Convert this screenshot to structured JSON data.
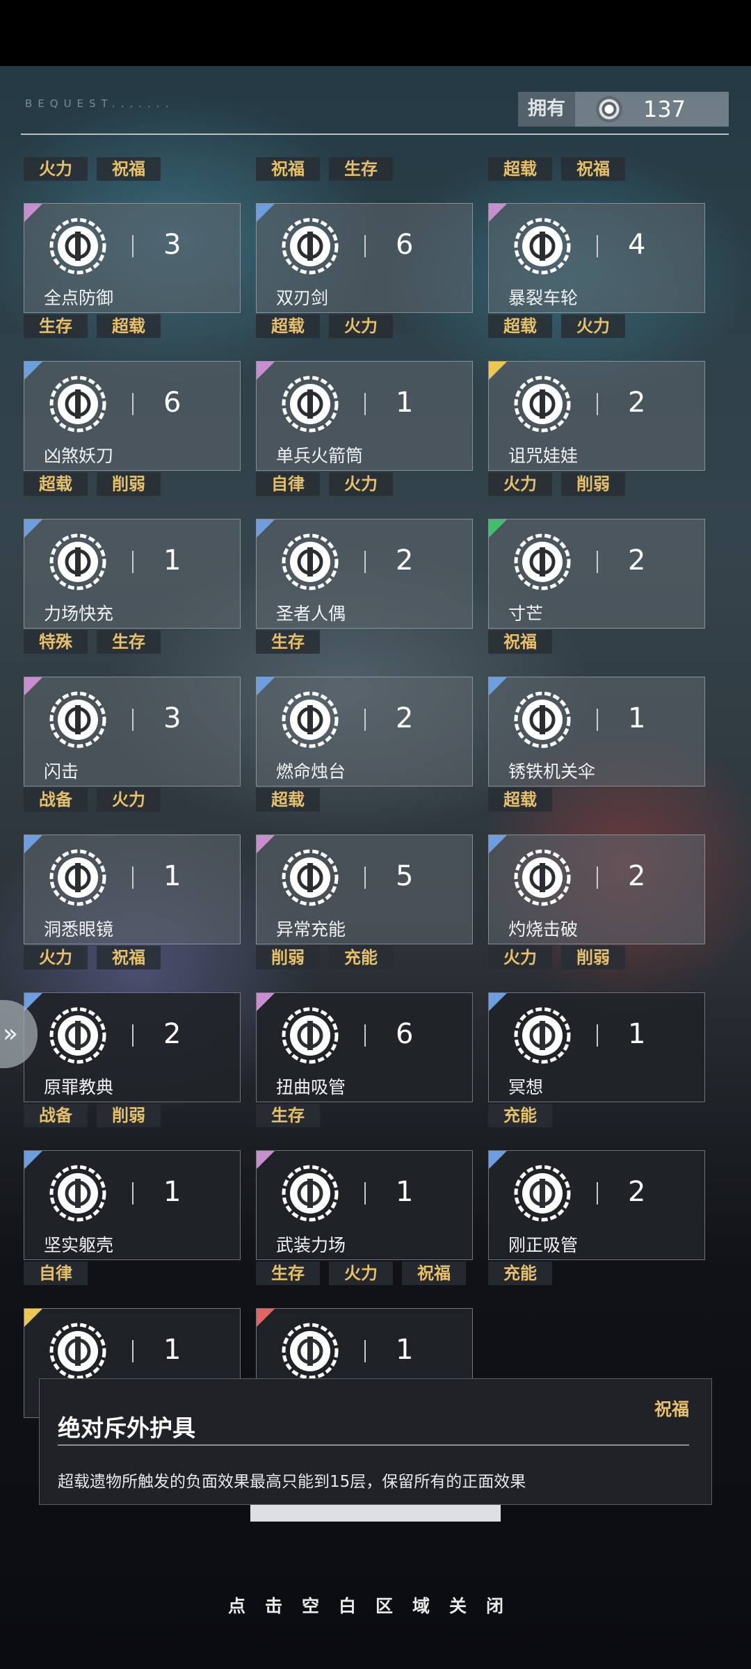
{
  "header": {
    "deco_text": "BEQUEST.......",
    "owned_label": "拥有",
    "owned_count": "137"
  },
  "colors": {
    "tag_text": "#e7c06a",
    "tri_purple": "#c88ed0",
    "tri_blue": "#6c9ee0",
    "tri_yellow": "#ecc84f",
    "tri_green": "#3fbf6a",
    "tri_red": "#e06565"
  },
  "top_tags": [
    [
      "火力",
      "祝福"
    ],
    [
      "祝福",
      "生存"
    ],
    [
      "超载",
      "祝福"
    ]
  ],
  "relics": [
    {
      "name": "全点防御",
      "count": "3",
      "rarity": "purple",
      "icon": "shield-icon",
      "tags": [
        "生存",
        "超载"
      ]
    },
    {
      "name": "双刃剑",
      "count": "6",
      "rarity": "blue",
      "icon": "double-blade-icon",
      "tags": [
        "超载",
        "火力"
      ]
    },
    {
      "name": "暴裂车轮",
      "count": "4",
      "rarity": "purple",
      "icon": "wheel-icon",
      "tags": [
        "超载",
        "火力"
      ]
    },
    {
      "name": "凶煞妖刀",
      "count": "6",
      "rarity": "blue",
      "icon": "demon-blade-icon",
      "tags": [
        "超载",
        "削弱"
      ]
    },
    {
      "name": "单兵火箭筒",
      "count": "1",
      "rarity": "purple",
      "icon": "rocket-launcher-icon",
      "tags": [
        "自律",
        "火力"
      ]
    },
    {
      "name": "诅咒娃娃",
      "count": "2",
      "rarity": "yellow",
      "icon": "voodoo-doll-icon",
      "tags": [
        "火力",
        "削弱"
      ]
    },
    {
      "name": "力场快充",
      "count": "1",
      "rarity": "blue",
      "icon": "force-field-charge-icon",
      "tags": [
        "特殊",
        "生存"
      ]
    },
    {
      "name": "圣者人偶",
      "count": "2",
      "rarity": "blue",
      "icon": "saint-figure-icon",
      "tags": [
        "生存"
      ]
    },
    {
      "name": "寸芒",
      "count": "2",
      "rarity": "green",
      "icon": "tiny-spike-icon",
      "tags": [
        "祝福"
      ]
    },
    {
      "name": "闪击",
      "count": "3",
      "rarity": "purple",
      "icon": "lightning-strike-icon",
      "tags": [
        "战备",
        "火力"
      ]
    },
    {
      "name": "燃命烛台",
      "count": "2",
      "rarity": "blue",
      "icon": "candelabra-icon",
      "tags": [
        "超载"
      ]
    },
    {
      "name": "锈铁机关伞",
      "count": "1",
      "rarity": "blue",
      "icon": "umbrella-icon",
      "tags": [
        "超载"
      ]
    },
    {
      "name": "洞悉眼镜",
      "count": "1",
      "rarity": "blue",
      "icon": "goggles-icon",
      "tags": [
        "火力",
        "祝福"
      ]
    },
    {
      "name": "异常充能",
      "count": "5",
      "rarity": "purple",
      "icon": "abnormal-charge-icon",
      "tags": [
        "削弱",
        "充能"
      ]
    },
    {
      "name": "灼烧击破",
      "count": "2",
      "rarity": "blue",
      "icon": "burn-break-icon",
      "tags": [
        "火力",
        "削弱"
      ]
    },
    {
      "name": "原罪教典",
      "count": "2",
      "rarity": "blue",
      "icon": "scripture-icon",
      "tags": [
        "战备",
        "削弱"
      ]
    },
    {
      "name": "扭曲吸管",
      "count": "6",
      "rarity": "purple",
      "icon": "twisted-straw-icon",
      "tags": [
        "生存"
      ]
    },
    {
      "name": "冥想",
      "count": "1",
      "rarity": "blue",
      "icon": "meditation-icon",
      "tags": [
        "充能"
      ]
    },
    {
      "name": "坚实躯壳",
      "count": "1",
      "rarity": "blue",
      "icon": "solid-shell-icon",
      "tags": [
        "自律"
      ]
    },
    {
      "name": "武装力场",
      "count": "1",
      "rarity": "purple",
      "icon": "armed-field-icon",
      "tags": [
        "生存",
        "火力",
        "祝福"
      ]
    },
    {
      "name": "刚正吸管",
      "count": "2",
      "rarity": "blue",
      "icon": "upright-straw-icon",
      "tags": [
        "充能"
      ]
    },
    {
      "name": "",
      "count": "1",
      "rarity": "yellow",
      "icon": "device-icon",
      "tags": []
    },
    {
      "name": "",
      "count": "1",
      "rarity": "red",
      "icon": "core-figure-icon",
      "tags": []
    }
  ],
  "tooltip": {
    "title": "绝对斥外护具",
    "tag": "祝福",
    "description": "超载遗物所触发的负面效果最高只能到15层，保留所有的正面效果"
  },
  "side_tab": {
    "icon": "double-chevron-right-icon",
    "glyph": "»"
  },
  "footer": {
    "close_hint": "点击空白区域关闭"
  }
}
